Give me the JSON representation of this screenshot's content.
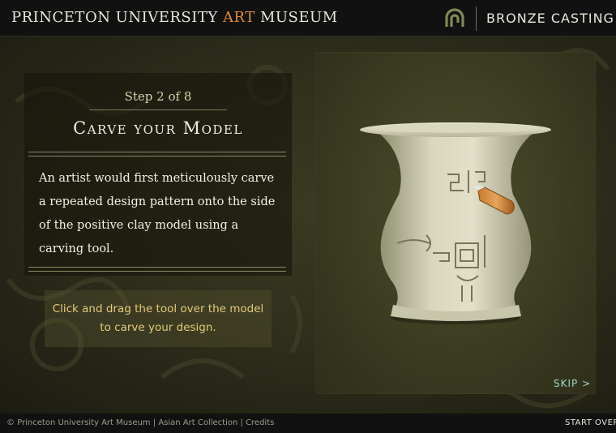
{
  "header": {
    "museum_prefix": "PRINCETON UNIVERSITY",
    "museum_art": "ART",
    "museum_suffix": "MUSEUM",
    "section_title": "BRONZE CASTING",
    "logo_icon": "spiral-logo-icon"
  },
  "lesson": {
    "step": "Step 2 of 8",
    "title": "Carve your Model",
    "body": "An artist would first meticulously carve a repeated design pattern onto the side of the positive clay model using a carving tool.",
    "instruction": "Click and drag the tool over the model to carve your design."
  },
  "interactive": {
    "model_name": "clay-vase-model",
    "tool_name": "carving-tool",
    "skip_label": "SKIP >"
  },
  "footer": {
    "copyright": "© Princeton University Art Museum",
    "separator1": "|",
    "collection": "Asian Art Collection",
    "separator2": "|",
    "credits": "Credits",
    "start_over": "START OVER"
  },
  "colors": {
    "accent_orange": "#e08a3a",
    "instruction_gold": "#e4c979",
    "skip_teal": "#9fd8c9",
    "background_olive": "#2f2f1c"
  }
}
